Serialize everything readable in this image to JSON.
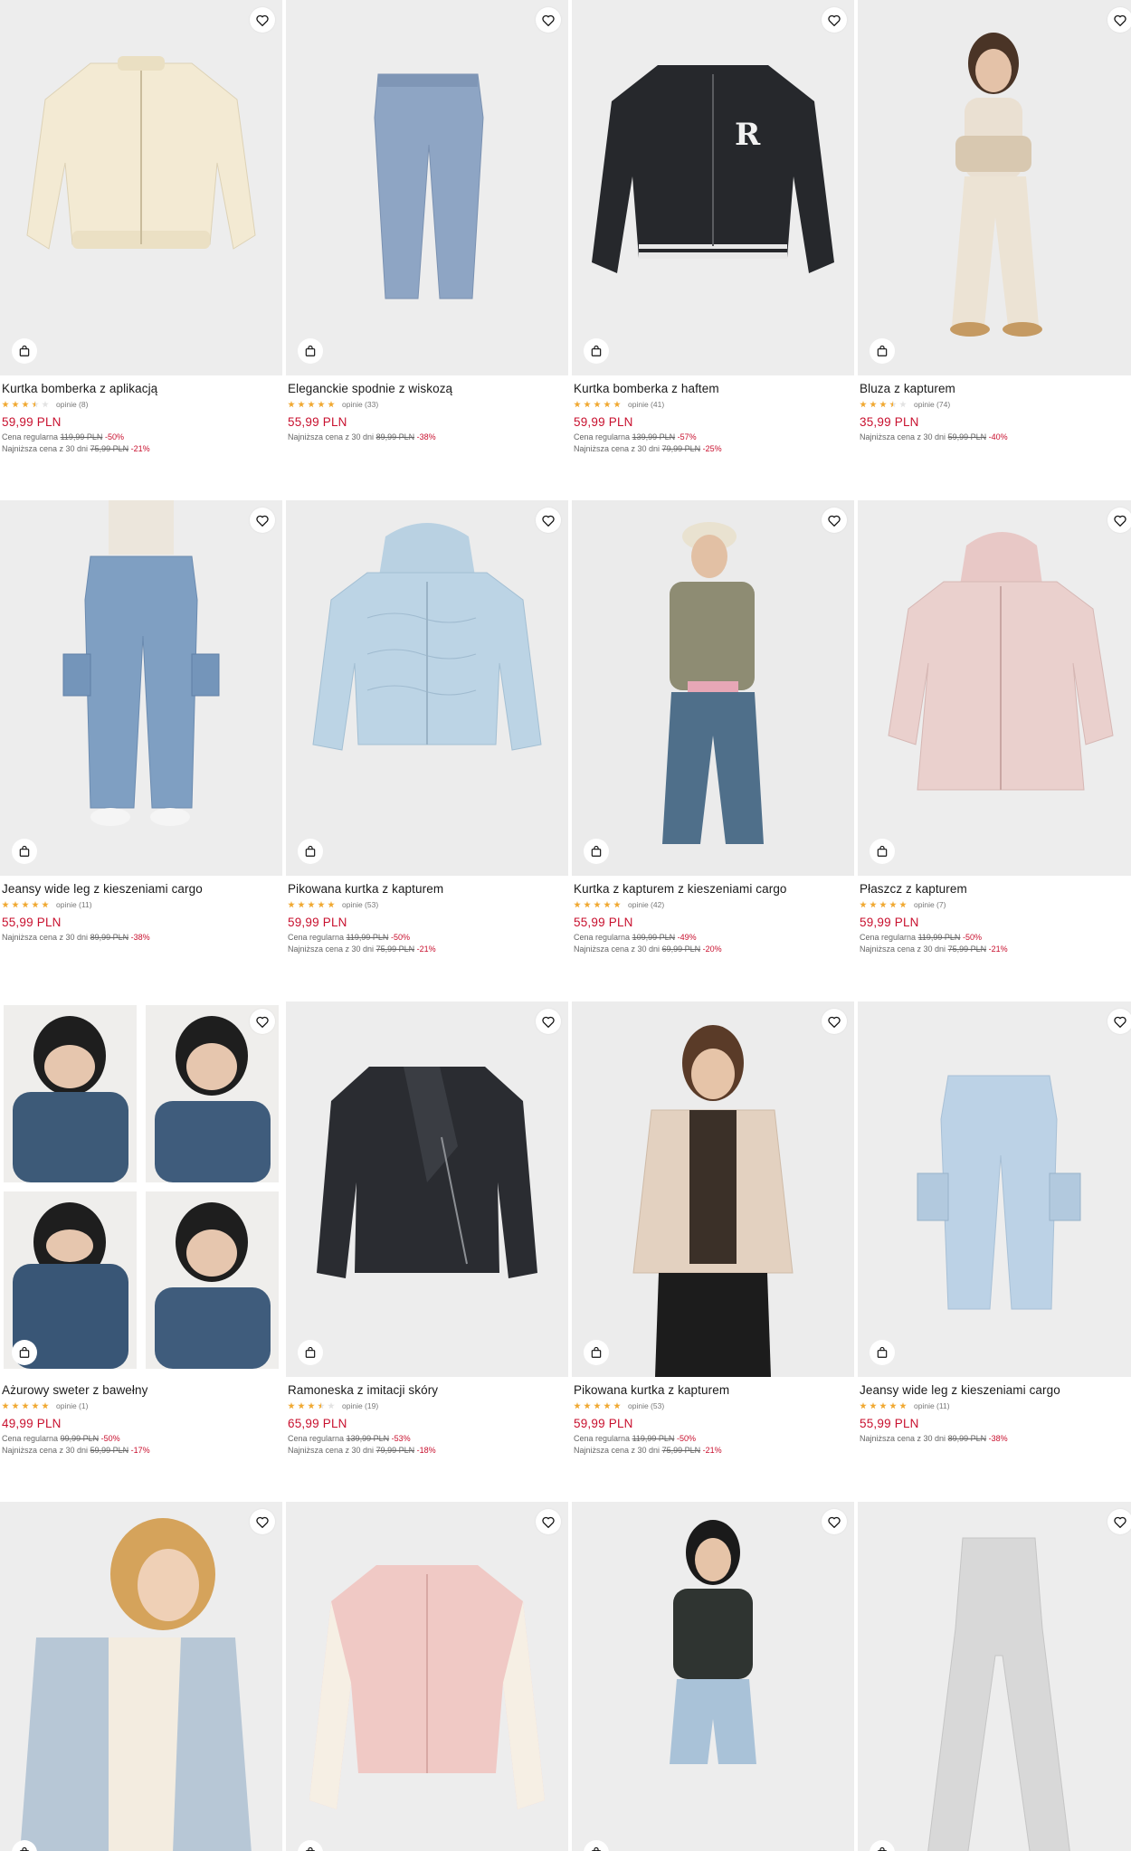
{
  "labels": {
    "regular": "Cena regularna",
    "lowest": "Najniższa cena z 30 dni",
    "reviews_prefix": "opinie"
  },
  "icons": {
    "wishlist": "heart-icon",
    "cart": "shopping-bag-icon",
    "rating": "star-icon"
  },
  "colors": {
    "price": "#c8102e",
    "star": "#f0a830"
  },
  "products": [
    {
      "name": "Kurtka bomberka z aplikacją",
      "rating": 3.5,
      "reviews": "opinie (8)",
      "price": "59,99 PLN",
      "regular_price": "119,99 PLN",
      "regular_discount": "-50%",
      "lowest_price": "75,99 PLN",
      "lowest_discount": "-21%"
    },
    {
      "name": "Eleganckie spodnie z wiskozą",
      "rating": 5,
      "reviews": "opinie (33)",
      "price": "55,99 PLN",
      "lowest_price": "89,99 PLN",
      "lowest_discount": "-38%"
    },
    {
      "name": "Kurtka bomberka z haftem",
      "rating": 5,
      "reviews": "opinie (41)",
      "price": "59,99 PLN",
      "regular_price": "139,99 PLN",
      "regular_discount": "-57%",
      "lowest_price": "79,99 PLN",
      "lowest_discount": "-25%"
    },
    {
      "name": "Bluza z kapturem",
      "rating": 3.5,
      "reviews": "opinie (74)",
      "price": "35,99 PLN",
      "lowest_price": "59,99 PLN",
      "lowest_discount": "-40%"
    },
    {
      "name": "Jeansy wide leg z kieszeniami cargo",
      "rating": 5,
      "reviews": "opinie (11)",
      "price": "55,99 PLN",
      "lowest_price": "89,99 PLN",
      "lowest_discount": "-38%"
    },
    {
      "name": "Pikowana kurtka z kapturem",
      "rating": 5,
      "reviews": "opinie (53)",
      "price": "59,99 PLN",
      "regular_price": "119,99 PLN",
      "regular_discount": "-50%",
      "lowest_price": "75,99 PLN",
      "lowest_discount": "-21%"
    },
    {
      "name": "Kurtka z kapturem z kieszeniami cargo",
      "rating": 5,
      "reviews": "opinie (42)",
      "price": "55,99 PLN",
      "regular_price": "109,99 PLN",
      "regular_discount": "-49%",
      "lowest_price": "69,99 PLN",
      "lowest_discount": "-20%"
    },
    {
      "name": "Płaszcz z kapturem",
      "rating": 5,
      "reviews": "opinie (7)",
      "price": "59,99 PLN",
      "regular_price": "119,99 PLN",
      "regular_discount": "-50%",
      "lowest_price": "75,99 PLN",
      "lowest_discount": "-21%"
    },
    {
      "name": "Ażurowy sweter z bawełny",
      "rating": 5,
      "reviews": "opinie (1)",
      "price": "49,99 PLN",
      "regular_price": "99,99 PLN",
      "regular_discount": "-50%",
      "lowest_price": "59,99 PLN",
      "lowest_discount": "-17%"
    },
    {
      "name": "Ramoneska z imitacji skóry",
      "rating": 3.5,
      "reviews": "opinie (19)",
      "price": "65,99 PLN",
      "regular_price": "139,99 PLN",
      "regular_discount": "-53%",
      "lowest_price": "79,99 PLN",
      "lowest_discount": "-18%"
    },
    {
      "name": "Pikowana kurtka z kapturem",
      "rating": 5,
      "reviews": "opinie (53)",
      "price": "59,99 PLN",
      "regular_price": "119,99 PLN",
      "regular_discount": "-50%",
      "lowest_price": "75,99 PLN",
      "lowest_discount": "-21%"
    },
    {
      "name": "Jeansy wide leg z kieszeniami cargo",
      "rating": 5,
      "reviews": "opinie (11)",
      "price": "55,99 PLN",
      "lowest_price": "89,99 PLN",
      "lowest_discount": "-38%"
    },
    {
      "name": "",
      "rating": 0,
      "reviews": "",
      "price": ""
    },
    {
      "name": "",
      "rating": 0,
      "reviews": "",
      "price": ""
    },
    {
      "name": "",
      "rating": 0,
      "reviews": "",
      "price": ""
    },
    {
      "name": "",
      "rating": 0,
      "reviews": "",
      "price": ""
    }
  ]
}
